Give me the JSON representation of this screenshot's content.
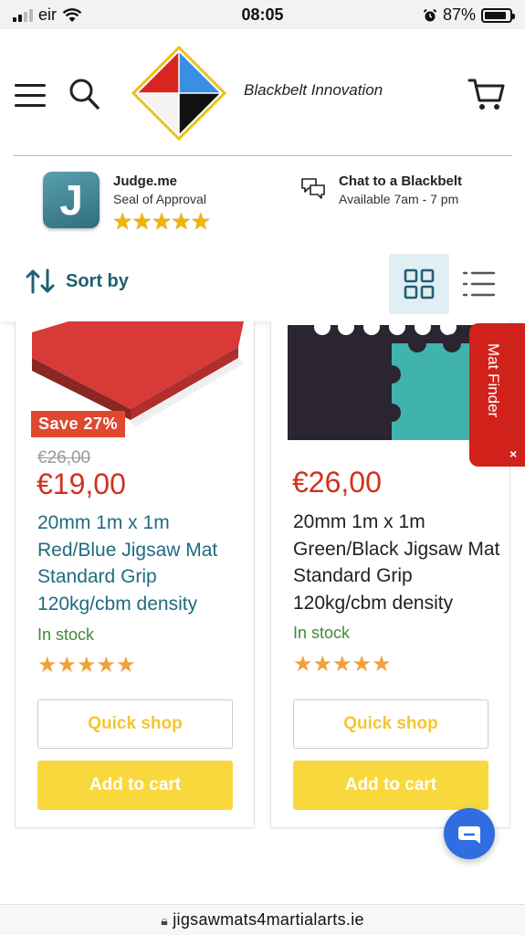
{
  "status_bar": {
    "carrier": "eir",
    "time": "08:05",
    "battery": "87%"
  },
  "header": {
    "brand": "Blackbelt Innovation"
  },
  "trust": {
    "judge_title": "Judge.me",
    "judge_sub": "Seal of Approval",
    "judge_letter": "J",
    "judge_stars": "★★★★★",
    "chat_title": "Chat to a Blackbelt",
    "chat_hours": "Available 7am - 7 pm"
  },
  "toolbar": {
    "sort_label": "Sort by",
    "active_view": "grid"
  },
  "products": [
    {
      "badge": "Save 27%",
      "price_old": "€26,00",
      "price": "€19,00",
      "title": "20mm 1m x 1m Red/Blue Jigsaw Mat Standard Grip 120kg/cbm density",
      "stock": "In stock",
      "rating": 5,
      "quick_shop": "Quick shop",
      "add_to_cart": "Add to cart"
    },
    {
      "price": "€26,00",
      "title": "20mm 1m x 1m Green/Black Jigsaw Mat Standard Grip 120kg/cbm density",
      "stock": "In stock",
      "rating": 5,
      "quick_shop": "Quick shop",
      "add_to_cart": "Add to cart"
    }
  ],
  "mat_finder": {
    "label": "Mat Finder",
    "close": "×"
  },
  "url_bar": {
    "url": "jigsawmats4martialarts.ie"
  },
  "icons": {
    "menu": "hamburger-icon",
    "search": "search-icon",
    "cart": "cart-icon",
    "chat": "chat-bubbles-icon",
    "sort": "sort-arrows-icon",
    "grid": "grid-view-icon",
    "list": "list-view-icon",
    "lock": "lock-icon"
  },
  "colors": {
    "accent": "#1f5f73",
    "sale": "#d0321f",
    "badge": "#e0482f",
    "cta": "#f8d83c",
    "stock": "#3f8a3a",
    "fab": "#2f6de0"
  }
}
